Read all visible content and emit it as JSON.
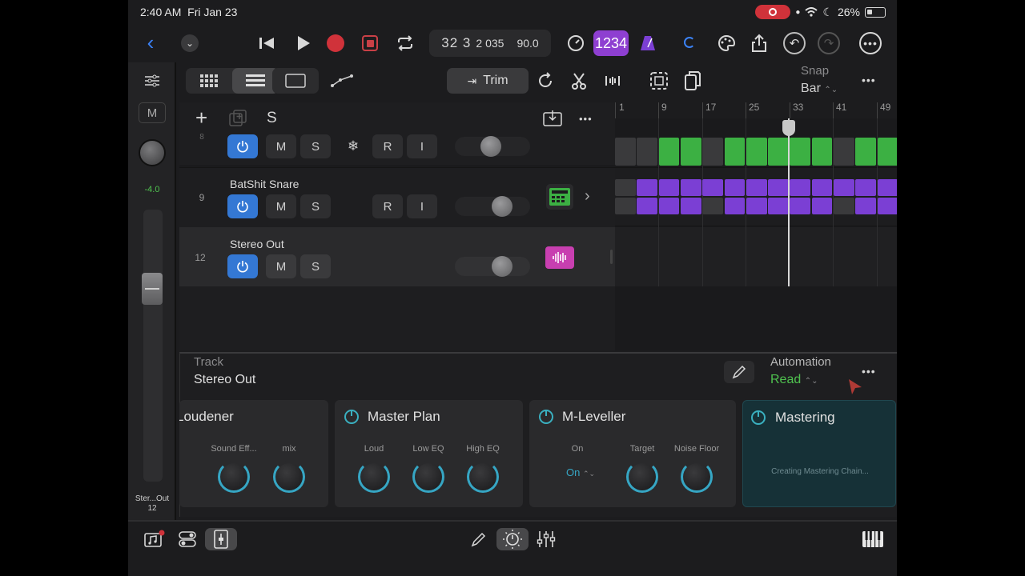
{
  "status": {
    "time": "2:40 AM",
    "date": "Fri Jan 23",
    "battery": "26%"
  },
  "transport": {
    "position_big": "32 3",
    "position_small": "2 035",
    "tempo": "90.0",
    "count_in": "1234"
  },
  "toolbar2": {
    "trim_label": "Trim",
    "snap_label": "Snap",
    "snap_value": "Bar"
  },
  "tracklist_header": {
    "solo_label": "S"
  },
  "sidebar": {
    "mute_label": "M",
    "volume": "-4.0",
    "track_name": "Ster...Out",
    "track_num": "12"
  },
  "ruler": {
    "marks": [
      "1",
      "9",
      "17",
      "25",
      "33",
      "41",
      "49"
    ]
  },
  "tracks": [
    {
      "number": "8",
      "name": "",
      "buttons": [
        "M",
        "S",
        "R",
        "I"
      ]
    },
    {
      "number": "9",
      "name": "BatShit Snare",
      "buttons": [
        "M",
        "S",
        "R",
        "I"
      ]
    },
    {
      "number": "12",
      "name": "Stereo Out",
      "buttons": [
        "M",
        "S"
      ]
    }
  ],
  "panel": {
    "track_label": "Track",
    "track_name": "Stereo Out",
    "automation_label": "Automation",
    "automation_value": "Read",
    "plugins": [
      {
        "title": "Loudener",
        "params": [
          "Sound Eff...",
          "mix"
        ]
      },
      {
        "title": "Master Plan",
        "params": [
          "Loud",
          "Low EQ",
          "High EQ"
        ]
      },
      {
        "title": "M-Leveller",
        "params": [
          "On",
          "Target",
          "Noise Floor"
        ],
        "on_value": "On"
      },
      {
        "title": "Mastering",
        "status": "Creating Mastering Chain..."
      }
    ]
  },
  "colors": {
    "accent_blue": "#3478d4",
    "green_region": "#3cb043",
    "purple_region": "#7b3fd4",
    "count_in": "#8e3fd1",
    "automation_green": "#4fc24f",
    "record_red": "#d0323a"
  }
}
